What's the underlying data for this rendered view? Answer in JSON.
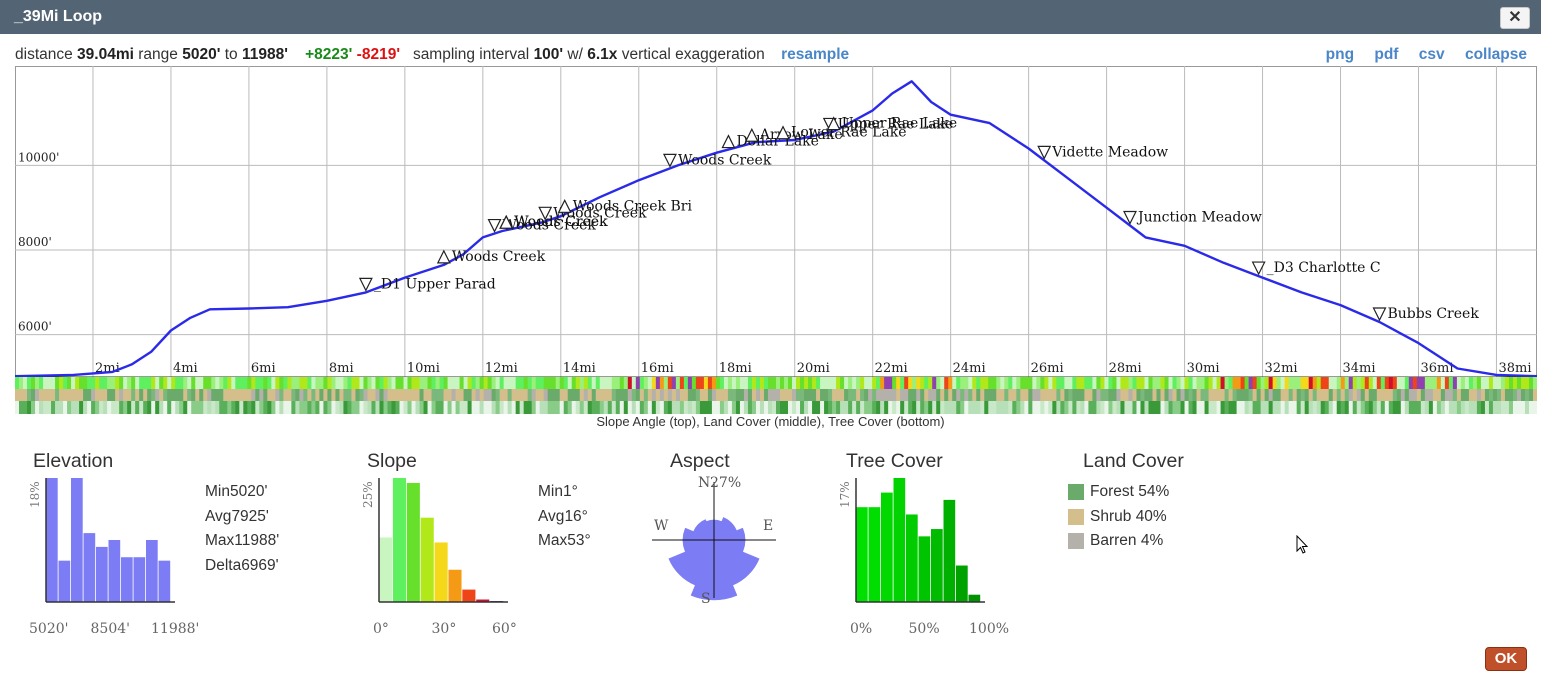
{
  "window": {
    "title": "_39Mi Loop",
    "close_label": "✕"
  },
  "stats": {
    "distance_label": "distance",
    "distance": "39.04mi",
    "range_label": "range",
    "range_min": "5020'",
    "to_label": "to",
    "range_max": "11988'",
    "gain": "+8223'",
    "loss": "-8219'",
    "sampling_label": "sampling interval",
    "interval": "100'",
    "w_label": "w/",
    "exaggeration": "6.1x",
    "vex_label": "vertical exaggeration",
    "resample": "resample"
  },
  "links": {
    "png": "png",
    "pdf": "pdf",
    "csv": "csv",
    "collapse": "collapse"
  },
  "chart_data": [
    {
      "type": "line",
      "name": "elevation-profile",
      "xlim": [
        0,
        39.04
      ],
      "ylim": [
        5000,
        12350
      ],
      "grid": true,
      "x_ticks": [
        "2mi",
        "4mi",
        "6mi",
        "8mi",
        "10mi",
        "12mi",
        "14mi",
        "16mi",
        "18mi",
        "20mi",
        "22mi",
        "24mi",
        "26mi",
        "28mi",
        "30mi",
        "32mi",
        "34mi",
        "36mi",
        "38mi"
      ],
      "y_ticks": [
        "6000'",
        "8000'",
        "10000'"
      ],
      "x": [
        0,
        1.5,
        2.5,
        3,
        3.5,
        4,
        4.5,
        5,
        6,
        7,
        8,
        9,
        10,
        11,
        11.5,
        12,
        12.5,
        13,
        13.5,
        14,
        15,
        16,
        17,
        18,
        19,
        20,
        21,
        22,
        22.5,
        23,
        23.5,
        24,
        25,
        26,
        27,
        28,
        29,
        30,
        31,
        32,
        33,
        34,
        35,
        36,
        37,
        38,
        39.04
      ],
      "y": [
        5020,
        5050,
        5120,
        5300,
        5600,
        6100,
        6400,
        6600,
        6620,
        6650,
        6800,
        7000,
        7350,
        7650,
        7900,
        8300,
        8450,
        8550,
        8650,
        8800,
        9250,
        9650,
        10000,
        10300,
        10550,
        10600,
        10800,
        11300,
        11700,
        11988,
        11500,
        11200,
        11000,
        10400,
        9700,
        9000,
        8300,
        8100,
        7700,
        7350,
        7000,
        6700,
        6300,
        5800,
        5200,
        5050,
        5020
      ],
      "waypoints": [
        {
          "name": "_D1 Upper Parad",
          "mi": 9.0,
          "dir": "down"
        },
        {
          "name": "Woods Creek",
          "mi": 11.0,
          "dir": "up"
        },
        {
          "name": "Woods Creek",
          "mi": 12.3,
          "dir": "down"
        },
        {
          "name": "Woods Creek",
          "mi": 12.6,
          "dir": "up"
        },
        {
          "name": "Woods Creek",
          "mi": 12.6,
          "dir": "up"
        },
        {
          "name": "Woods Creek",
          "mi": 13.6,
          "dir": "down"
        },
        {
          "name": "Woods Creek Bri",
          "mi": 14.1,
          "dir": "up"
        },
        {
          "name": "Woods Creek",
          "mi": 16.8,
          "dir": "down"
        },
        {
          "name": "Dollar Lake",
          "mi": 18.3,
          "dir": "up"
        },
        {
          "name": "Arrow Lake",
          "mi": 18.9,
          "dir": "up"
        },
        {
          "name": "Lower Rae Lake",
          "mi": 19.7,
          "dir": "up"
        },
        {
          "name": "Upper Rae Lake",
          "mi": 20.9,
          "dir": "down"
        },
        {
          "name": "Upper Rae Lake",
          "mi": 21.0,
          "dir": "up"
        },
        {
          "name": "Vidette Meadow",
          "mi": 26.4,
          "dir": "down"
        },
        {
          "name": "Junction Meadow",
          "mi": 28.6,
          "dir": "down"
        },
        {
          "name": "_D3 Charlotte C",
          "mi": 31.9,
          "dir": "down"
        },
        {
          "name": "Bubbs Creek",
          "mi": 35.0,
          "dir": "down"
        }
      ]
    },
    {
      "type": "bar",
      "name": "elevation-histogram",
      "title": "Elevation",
      "ymax_label": "18%",
      "x_tick_labels": [
        "5020'",
        "8504'",
        "11988'"
      ],
      "values": [
        18,
        6,
        18,
        10,
        8,
        9,
        6.5,
        6.5,
        9,
        6
      ],
      "ylim": [
        0,
        18
      ]
    },
    {
      "type": "bar",
      "name": "slope-histogram",
      "title": "Slope",
      "ymax_label": "25%",
      "x_tick_labels": [
        "0°",
        "30°",
        "60°"
      ],
      "values": [
        13,
        25,
        24,
        17,
        12,
        6.5,
        2.5,
        0.5,
        0.2
      ],
      "colors": [
        "#c8f5c0",
        "#5ef05e",
        "#66e02a",
        "#b0e81a",
        "#f5d81a",
        "#f59a14",
        "#ee4418",
        "#d0102a",
        "#4040b0"
      ],
      "ylim": [
        0,
        25
      ]
    },
    {
      "type": "pie",
      "name": "aspect-rose",
      "title": "Aspect",
      "max_label": "27%",
      "directions": [
        "N",
        "NE",
        "E",
        "SE",
        "S",
        "SW",
        "W",
        "NW"
      ],
      "values": [
        9,
        11,
        14,
        22,
        27,
        22,
        14,
        10
      ]
    },
    {
      "type": "bar",
      "name": "tree-cover-histogram",
      "title": "Tree Cover",
      "ymax_label": "17%",
      "x_tick_labels": [
        "0%",
        "50%",
        "100%"
      ],
      "values": [
        13,
        13,
        15,
        17,
        12,
        9,
        10,
        14,
        5,
        1
      ],
      "colors": [
        "#00e000",
        "#00dd00",
        "#00d800",
        "#00d300",
        "#00cc00",
        "#00c400",
        "#00bb00",
        "#00b000",
        "#00a200",
        "#009200"
      ],
      "ylim": [
        0,
        17
      ]
    }
  ],
  "elevation_stats": {
    "min_label": "Min",
    "min": "5020'",
    "avg_label": "Avg",
    "avg": "7925'",
    "max_label": "Max",
    "max": "11988'",
    "delta_label": "Delta",
    "delta": "6969'"
  },
  "slope_stats": {
    "min_label": "Min",
    "min": "1°",
    "avg_label": "Avg",
    "avg": "16°",
    "max_label": "Max",
    "max": "53°"
  },
  "aspect": {
    "n": "N",
    "e": "E",
    "s": "S",
    "w": "W"
  },
  "land_cover": {
    "title": "Land Cover",
    "items": [
      {
        "label": "Forest",
        "pct": "54%",
        "color": "#6aaa6a"
      },
      {
        "label": "Shrub",
        "pct": "40%",
        "color": "#d4bf8c"
      },
      {
        "label": "Barren",
        "pct": "4%",
        "color": "#b4b0aa"
      }
    ]
  },
  "bands_caption": "Slope Angle (top), Land Cover (middle), Tree Cover (bottom)",
  "ok_label": "OK"
}
